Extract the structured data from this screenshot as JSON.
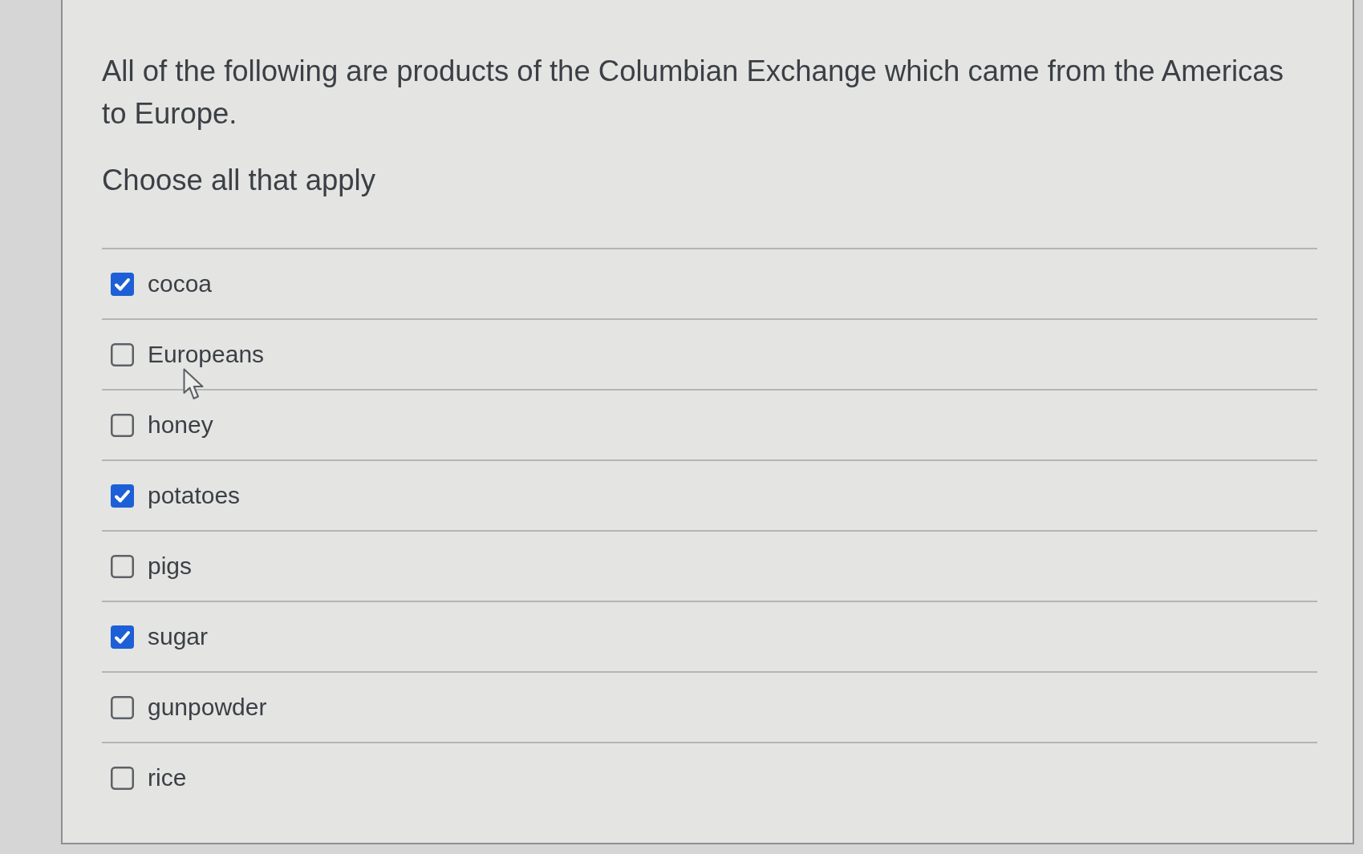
{
  "question": {
    "prompt": "All of the following are products of the Columbian Exchange which came from the Americas to Europe.",
    "instruction": "Choose all that apply"
  },
  "options": [
    {
      "label": "cocoa",
      "checked": true
    },
    {
      "label": "Europeans",
      "checked": false
    },
    {
      "label": "honey",
      "checked": false
    },
    {
      "label": "potatoes",
      "checked": true
    },
    {
      "label": "pigs",
      "checked": false
    },
    {
      "label": "sugar",
      "checked": true
    },
    {
      "label": "gunpowder",
      "checked": false
    },
    {
      "label": "rice",
      "checked": false
    }
  ]
}
